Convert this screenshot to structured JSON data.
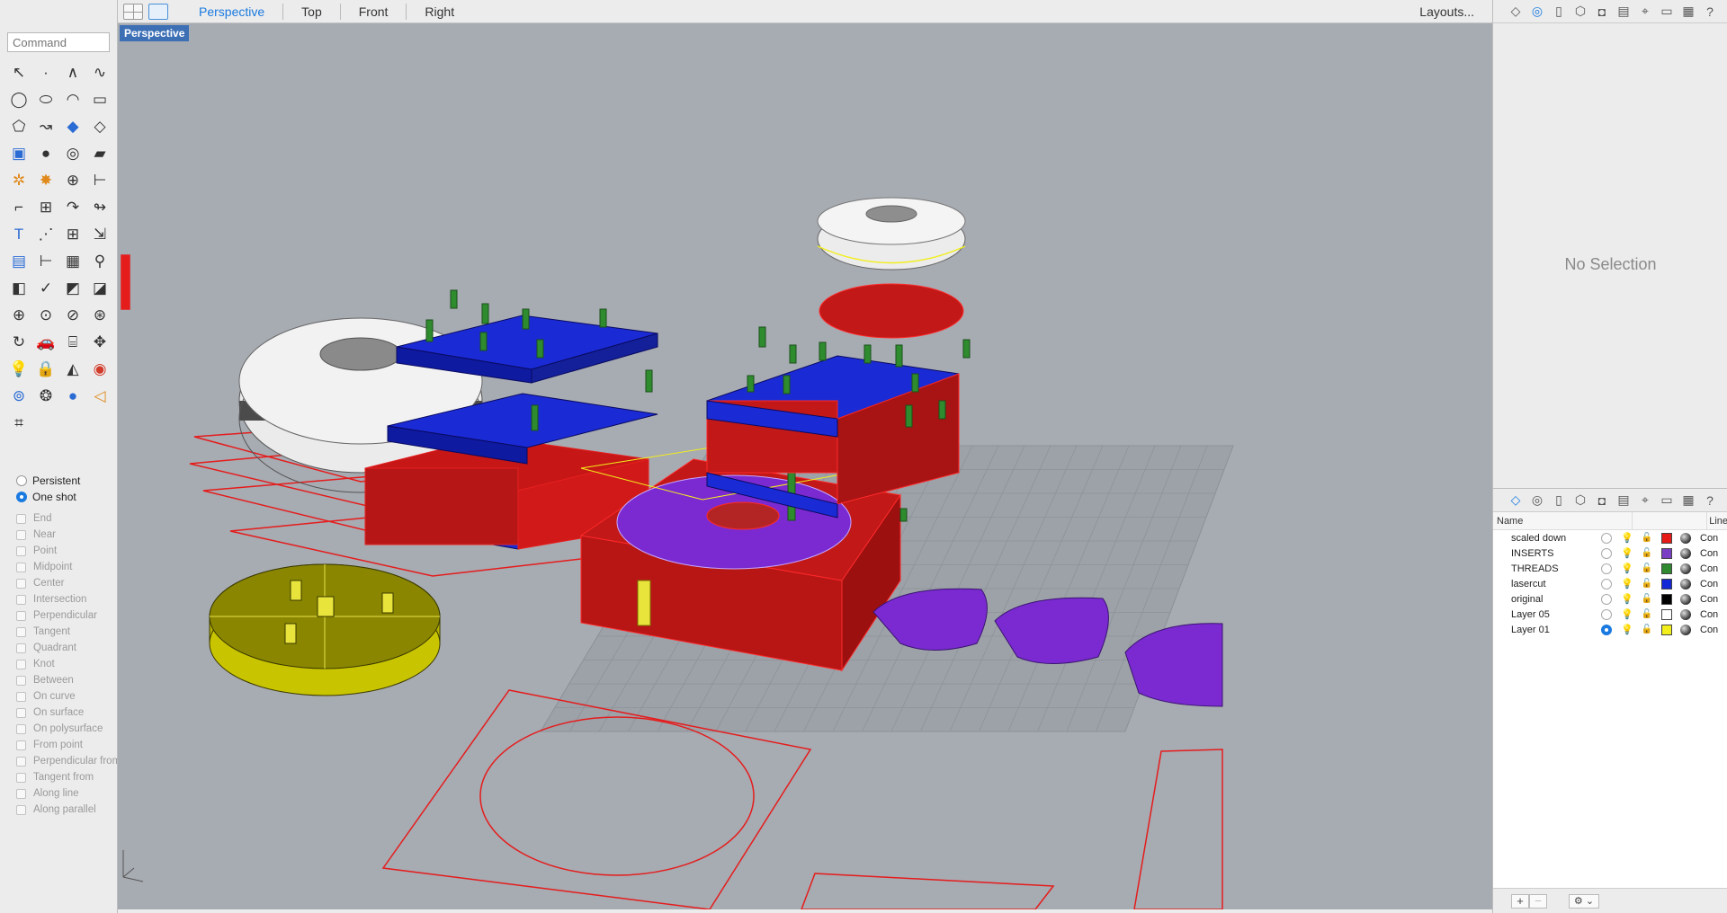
{
  "toolbar": {
    "tabs": [
      {
        "label": "Perspective",
        "active": true
      },
      {
        "label": "Top",
        "active": false
      },
      {
        "label": "Front",
        "active": false
      },
      {
        "label": "Right",
        "active": false
      }
    ],
    "layouts_label": "Layouts..."
  },
  "command": {
    "placeholder": "Command"
  },
  "viewport": {
    "label": "Perspective"
  },
  "osnap": {
    "modes": [
      {
        "label": "Persistent",
        "selected": false
      },
      {
        "label": "One shot",
        "selected": true
      }
    ],
    "snaps": [
      "End",
      "Near",
      "Point",
      "Midpoint",
      "Center",
      "Intersection",
      "Perpendicular",
      "Tangent",
      "Quadrant",
      "Knot",
      "Between",
      "On curve",
      "On surface",
      "On polysurface",
      "From point",
      "Perpendicular from",
      "Tangent from",
      "Along line",
      "Along parallel"
    ]
  },
  "properties": {
    "empty_text": "No Selection"
  },
  "layers": {
    "header": {
      "name": "Name",
      "linetype": "Line"
    },
    "rows": [
      {
        "name": "scaled down",
        "color": "#e41b17",
        "current": false,
        "bulb_on": true,
        "locked": false,
        "linetype": "Con"
      },
      {
        "name": "INSERTS",
        "color": "#7b3fc4",
        "current": false,
        "bulb_on": true,
        "locked": false,
        "linetype": "Con"
      },
      {
        "name": "THREADS",
        "color": "#2f8a2f",
        "current": false,
        "bulb_on": true,
        "locked": false,
        "linetype": "Con"
      },
      {
        "name": "lasercut",
        "color": "#1227d6",
        "current": false,
        "bulb_on": true,
        "locked": false,
        "linetype": "Con"
      },
      {
        "name": "original",
        "color": "#000000",
        "current": false,
        "bulb_on": false,
        "locked": true,
        "linetype": "Con"
      },
      {
        "name": "Layer 05",
        "color": "#ffffff",
        "current": false,
        "bulb_on": true,
        "locked": false,
        "linetype": "Con"
      },
      {
        "name": "Layer 01",
        "color": "#f2ee1c",
        "current": true,
        "bulb_on": false,
        "locked": false,
        "linetype": "Con"
      }
    ],
    "footer": {
      "add": "+",
      "remove": "−"
    }
  },
  "icons": {
    "tools": [
      "select-arrow-icon",
      "point-icon",
      "polyline-icon",
      "curve-icon",
      "circle-icon",
      "ellipse-icon",
      "arc-icon",
      "rectangle-icon",
      "polygon-icon",
      "freeform-icon",
      "surface-icon",
      "surface-edit-icon",
      "box-icon",
      "sphere-icon",
      "cylinder-icon",
      "plane-icon",
      "gear-solid-icon",
      "explode-icon",
      "boolean-icon",
      "trim-icon",
      "fillet-icon",
      "group-icon",
      "arc-blend-icon",
      "curve-blend-icon",
      "text-icon",
      "array-icon",
      "grid-array-icon",
      "transform-icon",
      "box-edit-icon",
      "dimension-icon",
      "matrix-icon",
      "analyze-icon",
      "cut-icon",
      "check-icon",
      "paint-icon",
      "bucket-icon",
      "zoom-icon",
      "zoom-window-icon",
      "zoom-extents-icon",
      "magnify-icon",
      "rotate-view-icon",
      "car-icon",
      "camera-icon",
      "pan-icon",
      "light-icon",
      "lock-icon",
      "render-icon",
      "color-wheel-icon",
      "wireframe-sphere-icon",
      "shaded-sphere-icon",
      "blue-sphere-icon",
      "cone-icon",
      "gumball-icon"
    ],
    "colors": {
      "accent": "#1a7ae0",
      "viewport_bg": "#a7abb2",
      "label_bg": "#3d6fb5"
    }
  }
}
